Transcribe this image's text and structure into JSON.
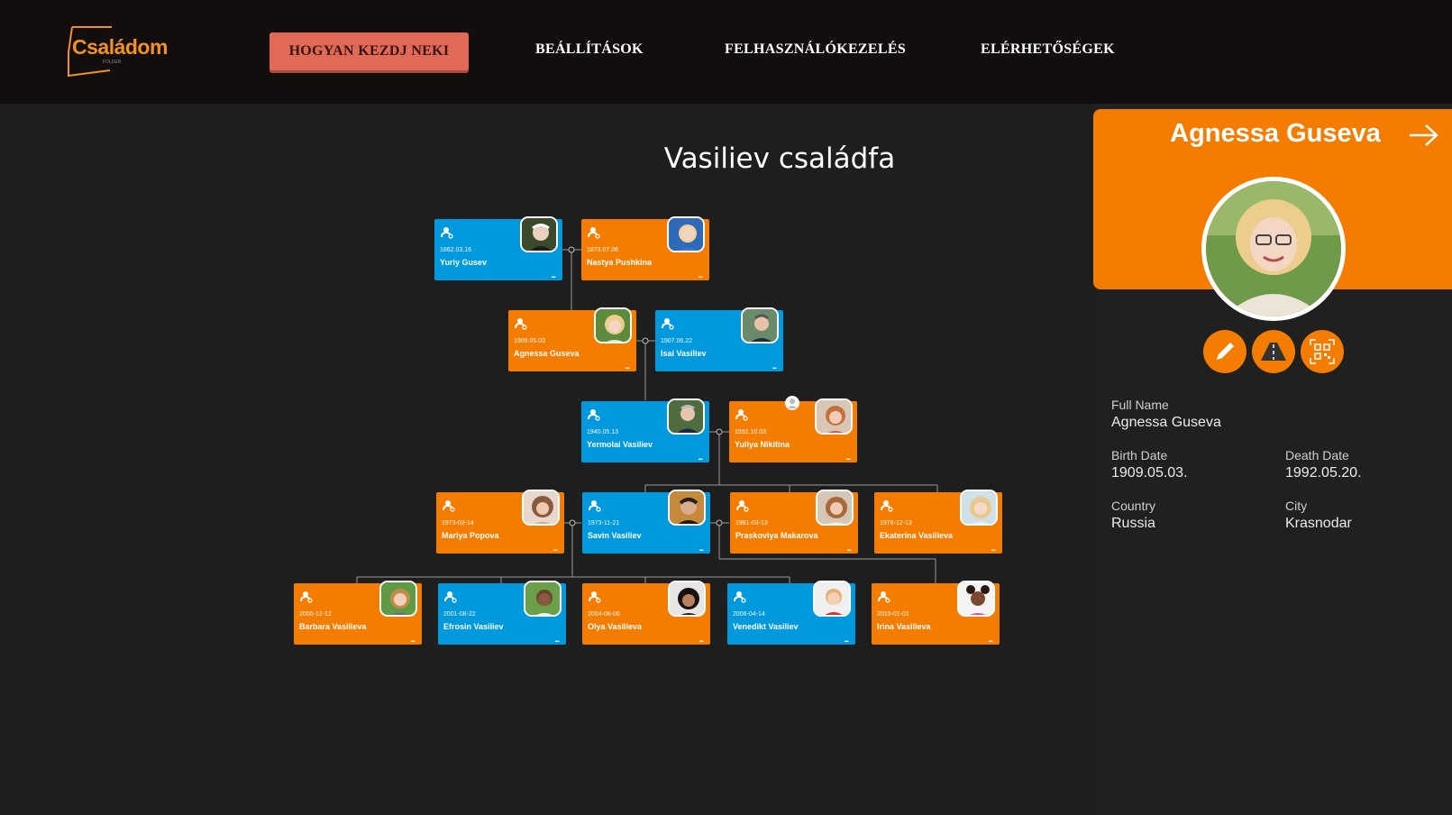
{
  "header": {
    "logo_text": "Családom",
    "logo_sub": "FOLDER",
    "nav": {
      "start": "HOGYAN KEZDJ NEKI",
      "settings": "BEÁLLÍTÁSOK",
      "users": "FELHASZNÁLÓKEZELÉS",
      "contacts": "ELÉRHETŐSÉGEK"
    }
  },
  "tree": {
    "title": "Vasiliev családfa",
    "more_label": "...",
    "cards": [
      {
        "date": "1862.03.16",
        "name": "Yuriy Gusev"
      },
      {
        "date": "1873.07.06",
        "name": "Nastya Pushkina"
      },
      {
        "date": "1909.05.03",
        "name": "Agnessa Guseva"
      },
      {
        "date": "1907.06.22",
        "name": "Isai Vasiliev"
      },
      {
        "date": "1940.05.13",
        "name": "Yermolai Vasiliev"
      },
      {
        "date": "1932.10.03",
        "name": "Yuliya Nikitina"
      },
      {
        "date": "1973-03-14",
        "name": "Mariya Popova"
      },
      {
        "date": "1973-11-21",
        "name": "Savin Vasiliev"
      },
      {
        "date": "1981-03-13",
        "name": "Praskoviya Makarova"
      },
      {
        "date": "1976-12-13",
        "name": "Ekaterina Vasilieva"
      },
      {
        "date": "2000-12-12",
        "name": "Barbara Vasilieva"
      },
      {
        "date": "2001-08-22",
        "name": "Efrosin Vasiliev"
      },
      {
        "date": "2004-08-06",
        "name": "Olya Vasilieva"
      },
      {
        "date": "2006-04-14",
        "name": "Venedikt Vasiliev"
      },
      {
        "date": "2010-01-01",
        "name": "Irina Vasilieva"
      }
    ]
  },
  "panel": {
    "name": "Agnessa Guseva",
    "fields": {
      "full_name_label": "Full Name",
      "full_name": "Agnessa Guseva",
      "birth_label": "Birth Date",
      "birth": "1909.05.03.",
      "death_label": "Death Date",
      "death": "1992.05.20.",
      "country_label": "Country",
      "country": "Russia",
      "city_label": "City",
      "city": "Krasnodar"
    },
    "actions": [
      "edit-icon",
      "road-icon",
      "qr-code-icon"
    ]
  },
  "colors": {
    "female": "#f47c00",
    "male": "#0099dd",
    "header_bg": "#130e0e",
    "page_bg": "#1e1e1e",
    "nav_button": "#e06a57"
  }
}
